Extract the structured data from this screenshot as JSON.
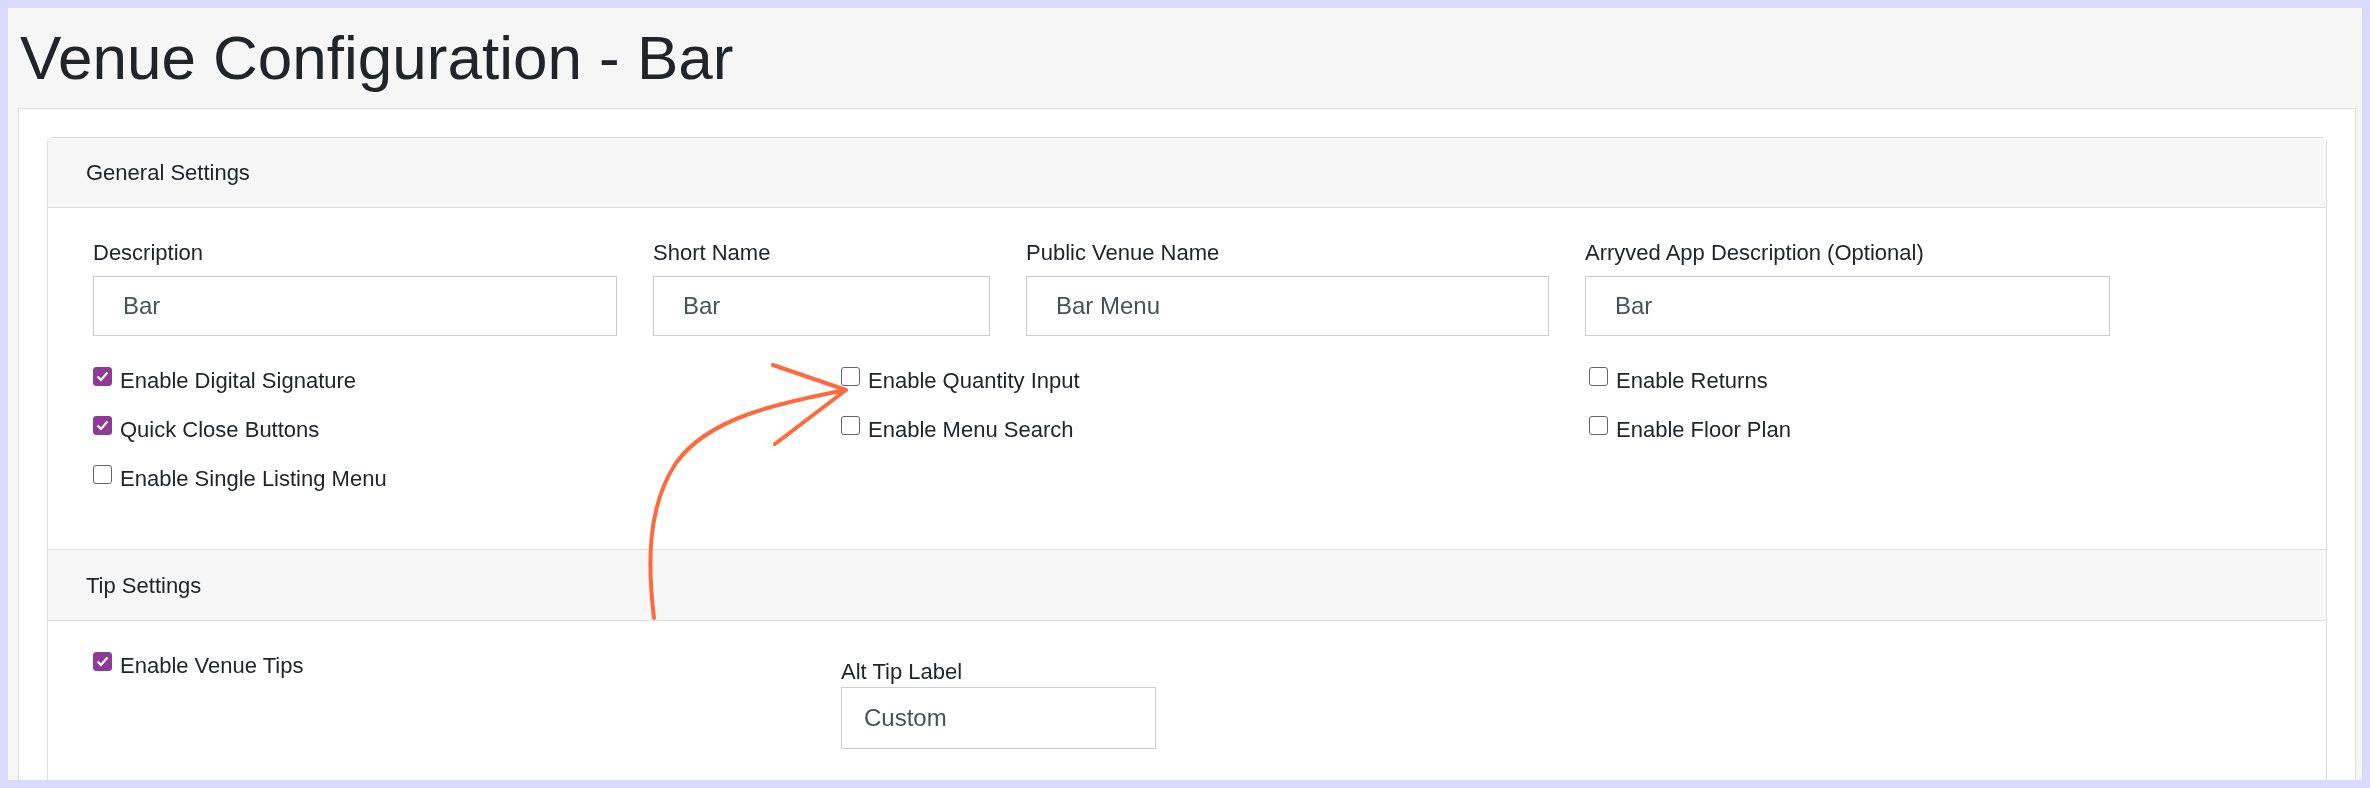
{
  "page": {
    "title": "Venue Configuration - Bar"
  },
  "general_settings": {
    "title": "General Settings",
    "fields": [
      {
        "label": "Description",
        "value": "Bar"
      },
      {
        "label": "Short Name",
        "value": "Bar"
      },
      {
        "label": "Public Venue Name",
        "value": "Bar Menu"
      },
      {
        "label": "Arryved App Description (Optional)",
        "value": "Bar"
      }
    ],
    "checkbox_columns": [
      [
        {
          "label": "Enable Digital Signature",
          "checked": true
        },
        {
          "label": "Quick Close Buttons",
          "checked": true
        },
        {
          "label": "Enable Single Listing Menu",
          "checked": false
        }
      ],
      [
        {
          "label": "Enable Quantity Input",
          "checked": false
        },
        {
          "label": "Enable Menu Search",
          "checked": false
        }
      ],
      [
        {
          "label": "Enable Returns",
          "checked": false
        },
        {
          "label": "Enable Floor Plan",
          "checked": false
        }
      ]
    ]
  },
  "tip_settings": {
    "title": "Tip Settings",
    "checkboxes": [
      {
        "label": "Enable Venue Tips",
        "checked": true
      }
    ],
    "alt_tip": {
      "label": "Alt Tip Label",
      "value": "Custom"
    }
  }
}
